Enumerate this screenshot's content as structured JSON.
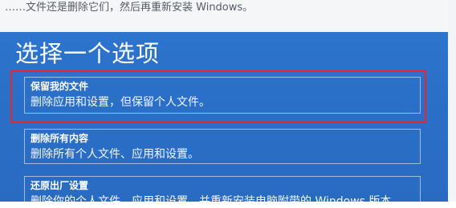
{
  "top_caption": "……文件还是删除它们，然后再重新安装 Windows。",
  "dialog": {
    "title": "选择一个选项",
    "options": [
      {
        "title": "保留我的文件",
        "description": "删除应用和设置，但保留个人文件。"
      },
      {
        "title": "删除所有内容",
        "description": "删除所有个人文件、应用和设置。"
      },
      {
        "title": "还原出厂设置",
        "description": "删除你的个人文件、应用和设置，并重新安装电脑附带的 Windows 版本"
      }
    ]
  },
  "colors": {
    "panel_blue": "#2d74cc",
    "highlight_red": "#e8242c",
    "text": "#ffffff"
  }
}
